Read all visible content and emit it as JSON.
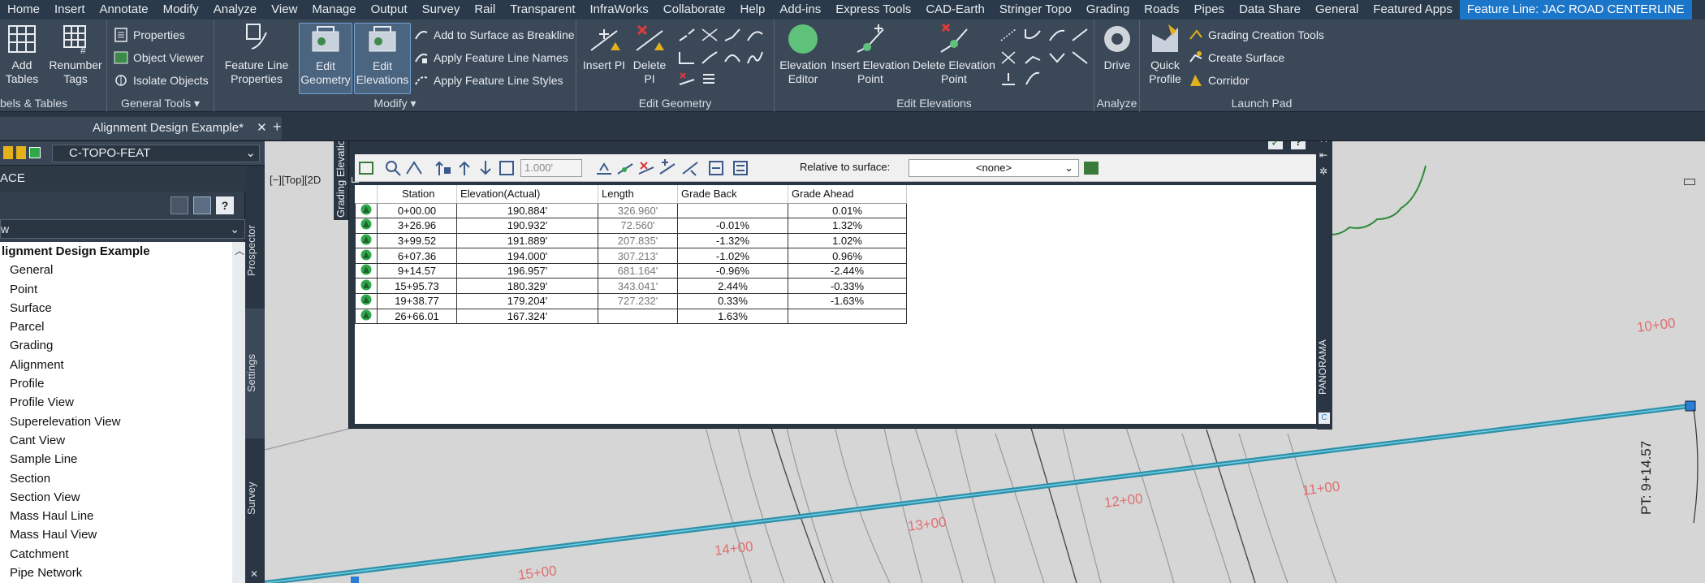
{
  "menu": [
    "Home",
    "Insert",
    "Annotate",
    "Modify",
    "Analyze",
    "View",
    "Manage",
    "Output",
    "Survey",
    "Rail",
    "Transparent",
    "InfraWorks",
    "Collaborate",
    "Help",
    "Add-ins",
    "Express Tools",
    "CAD-Earth",
    "Stringer Topo",
    "Grading",
    "Roads",
    "Pipes",
    "Data Share",
    "General",
    "Featured Apps",
    "Feature Line: JAC ROAD CENTERLINE"
  ],
  "ribbon": {
    "panel1": {
      "title": "bels & Tables",
      "add_tables": "Add\nTables",
      "renumber_tags": "Renumber\nTags"
    },
    "general_tools": {
      "title": "General Tools",
      "properties": "Properties",
      "object_viewer": "Object Viewer",
      "isolate_objects": "Isolate Objects"
    },
    "modify": {
      "title": "Modify",
      "feature_line_properties": "Feature Line\nProperties",
      "edit_geometry": "Edit\nGeometry",
      "edit_elevations": "Edit\nElevations",
      "add_breakline": "Add to Surface as Breakline",
      "apply_names": "Apply Feature Line Names",
      "apply_styles": "Apply Feature Line Styles"
    },
    "edit_geometry": {
      "title": "Edit Geometry",
      "insert_pi": "Insert PI",
      "delete_pi": "Delete PI"
    },
    "edit_elevations": {
      "title": "Edit Elevations",
      "elevation_editor": "Elevation\nEditor",
      "insert_elevation_point": "Insert Elevation\nPoint",
      "delete_elevation_point": "Delete Elevation\nPoint"
    },
    "analyze": {
      "title": "Analyze",
      "drive": "Drive"
    },
    "launch_pad": {
      "title": "Launch Pad",
      "quick_profile": "Quick\nProfile",
      "grading_creation_tools": "Grading Creation Tools",
      "create_surface": "Create Surface",
      "corridor": "Corridor"
    }
  },
  "doc_tab": "Alignment Design Example*",
  "layer": "C-TOPO-FEAT",
  "toolspace": {
    "header": "ACE",
    "selector": "w",
    "root": "lignment Design Example",
    "items": [
      "General",
      "Point",
      "Surface",
      "Parcel",
      "Grading",
      "Alignment",
      "Profile",
      "Profile View",
      "Superelevation View",
      "Cant View",
      "Sample Line",
      "Section",
      "Section View",
      "Mass Haul Line",
      "Mass Haul View",
      "Catchment",
      "Pipe Network"
    ],
    "tabs": [
      "Prospector",
      "Settings",
      "Survey"
    ]
  },
  "viewport": {
    "view_label": "[−][Top][2D",
    "stations": [
      "10+00",
      "11+00",
      "12+00",
      "13+00",
      "14+00",
      "15+00"
    ],
    "pt_label": "PT: 9+14.57"
  },
  "panorama": {
    "side_title": "Grading Elevation E...",
    "right_title": "PANORAMA",
    "distance_value": "1.000'",
    "relative_label": "Relative to surface:",
    "relative_value": "<none>",
    "columns": [
      "Station",
      "Elevation(Actual)",
      "Length",
      "Grade Back",
      "Grade Ahead"
    ],
    "rows": [
      {
        "station": "0+00.00",
        "elev": "190.884'",
        "len": "326.960'",
        "back": "",
        "ahead": "0.01%"
      },
      {
        "station": "3+26.96",
        "elev": "190.932'",
        "len": "72.560'",
        "back": "-0.01%",
        "ahead": "1.32%"
      },
      {
        "station": "3+99.52",
        "elev": "191.889'",
        "len": "207.835'",
        "back": "-1.32%",
        "ahead": "1.02%"
      },
      {
        "station": "6+07.36",
        "elev": "194.000'",
        "len": "307.213'",
        "back": "-1.02%",
        "ahead": "0.96%"
      },
      {
        "station": "9+14.57",
        "elev": "196.957'",
        "len": "681.164'",
        "back": "-0.96%",
        "ahead": "-2.44%"
      },
      {
        "station": "15+95.73",
        "elev": "180.329'",
        "len": "343.041'",
        "back": "2.44%",
        "ahead": "-0.33%"
      },
      {
        "station": "19+38.77",
        "elev": "179.204'",
        "len": "727.232'",
        "back": "0.33%",
        "ahead": "-1.63%"
      },
      {
        "station": "26+66.01",
        "elev": "167.324'",
        "len": "",
        "back": "1.63%",
        "ahead": ""
      }
    ]
  }
}
